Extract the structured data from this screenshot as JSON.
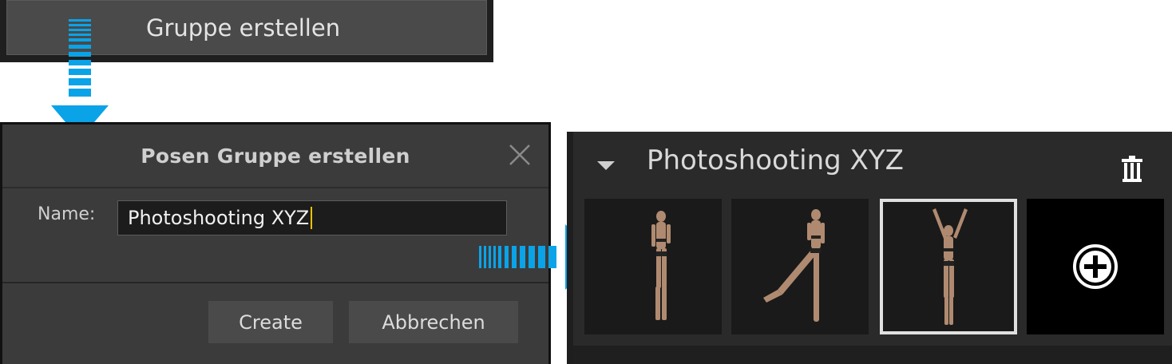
{
  "top_button": {
    "label": "Gruppe erstellen"
  },
  "dialog": {
    "title": "Posen Gruppe erstellen",
    "name_label": "Name:",
    "name_value": "Photoshooting XYZ",
    "create_label": "Create",
    "cancel_label": "Abbrechen"
  },
  "panel": {
    "group_title": "Photoshooting XYZ",
    "thumbnails": [
      {
        "name": "pose-standing",
        "selected": false
      },
      {
        "name": "pose-kick",
        "selected": false
      },
      {
        "name": "pose-arms-up",
        "selected": true
      }
    ],
    "add_icon": "plus-circle-icon",
    "trash_icon": "trash-icon",
    "collapse_icon": "caret-down-icon"
  },
  "colors": {
    "arrow": "#0aa3e8",
    "dialog_bg": "#3b3b3b",
    "button_bg": "#4a4a4a",
    "selected_border": "#e0e0e0",
    "caret": "#f0c000"
  }
}
